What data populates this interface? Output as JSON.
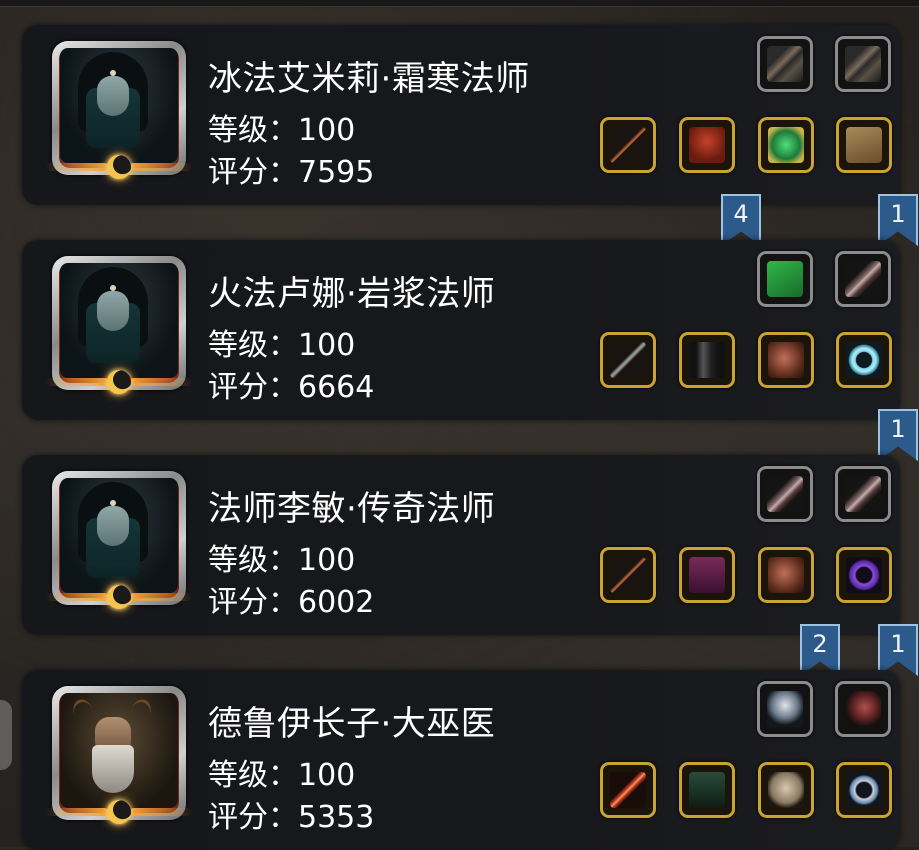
{
  "labels": {
    "level_prefix": "等级：",
    "score_prefix": "评分："
  },
  "characters": [
    {
      "name": "冰法艾米莉·霜寒法师",
      "level": "100",
      "score": "7595",
      "portrait": "hooded-mage-portrait",
      "top_slots": [
        {
          "icon": "dark-glove-icon",
          "frame": "grey"
        },
        {
          "icon": "dark-glove-icon",
          "frame": "grey"
        }
      ],
      "bottom_slots": [
        {
          "icon": "staff-icon",
          "frame": "gold"
        },
        {
          "icon": "red-armor-icon",
          "frame": "gold"
        },
        {
          "icon": "green-gem-icon",
          "frame": "gold"
        },
        {
          "icon": "scroll-icon",
          "frame": "gold"
        }
      ],
      "badges": [
        {
          "value": "4",
          "slot_index": 1
        },
        {
          "value": "1",
          "slot_index": 3
        }
      ]
    },
    {
      "name": "火法卢娜·岩浆法师",
      "level": "100",
      "score": "6664",
      "portrait": "hooded-mage-portrait",
      "top_slots": [
        {
          "icon": "green-spellbook-icon",
          "frame": "grey"
        },
        {
          "icon": "feather-icon",
          "frame": "grey"
        }
      ],
      "bottom_slots": [
        {
          "icon": "wand-icon",
          "frame": "gold"
        },
        {
          "icon": "black-robe-icon",
          "frame": "gold"
        },
        {
          "icon": "pauldron-icon",
          "frame": "gold"
        },
        {
          "icon": "frost-ring-icon",
          "frame": "gold"
        }
      ],
      "badges": [
        {
          "value": "1",
          "slot_index": 3
        }
      ]
    },
    {
      "name": "法师李敏·传奇法师",
      "level": "100",
      "score": "6002",
      "portrait": "hooded-mage-portrait",
      "top_slots": [
        {
          "icon": "feather-icon",
          "frame": "grey"
        },
        {
          "icon": "feather-icon",
          "frame": "grey"
        }
      ],
      "bottom_slots": [
        {
          "icon": "staff-icon",
          "frame": "gold"
        },
        {
          "icon": "purple-robe-icon",
          "frame": "gold"
        },
        {
          "icon": "pauldron-icon",
          "frame": "gold"
        },
        {
          "icon": "purple-ring-icon",
          "frame": "gold"
        }
      ],
      "badges": [
        {
          "value": "2",
          "slot_index": 2
        },
        {
          "value": "1",
          "slot_index": 3
        }
      ]
    },
    {
      "name": "德鲁伊长子·大巫医",
      "level": "100",
      "score": "5353",
      "portrait": "druid-elder-portrait",
      "top_slots": [
        {
          "icon": "silver-emblem-icon",
          "frame": "grey"
        },
        {
          "icon": "horn-icon",
          "frame": "grey"
        }
      ],
      "bottom_slots": [
        {
          "icon": "flame-staff-icon",
          "frame": "gold"
        },
        {
          "icon": "green-robe-icon",
          "frame": "gold"
        },
        {
          "icon": "skull-mask-icon",
          "frame": "gold"
        },
        {
          "icon": "sapphire-ring-icon",
          "frame": "gold"
        }
      ],
      "badges": []
    }
  ],
  "colors": {
    "badge": "#2c5a8a",
    "gold_frame": "#c9a431",
    "grey_frame": "#8c8c8c"
  }
}
